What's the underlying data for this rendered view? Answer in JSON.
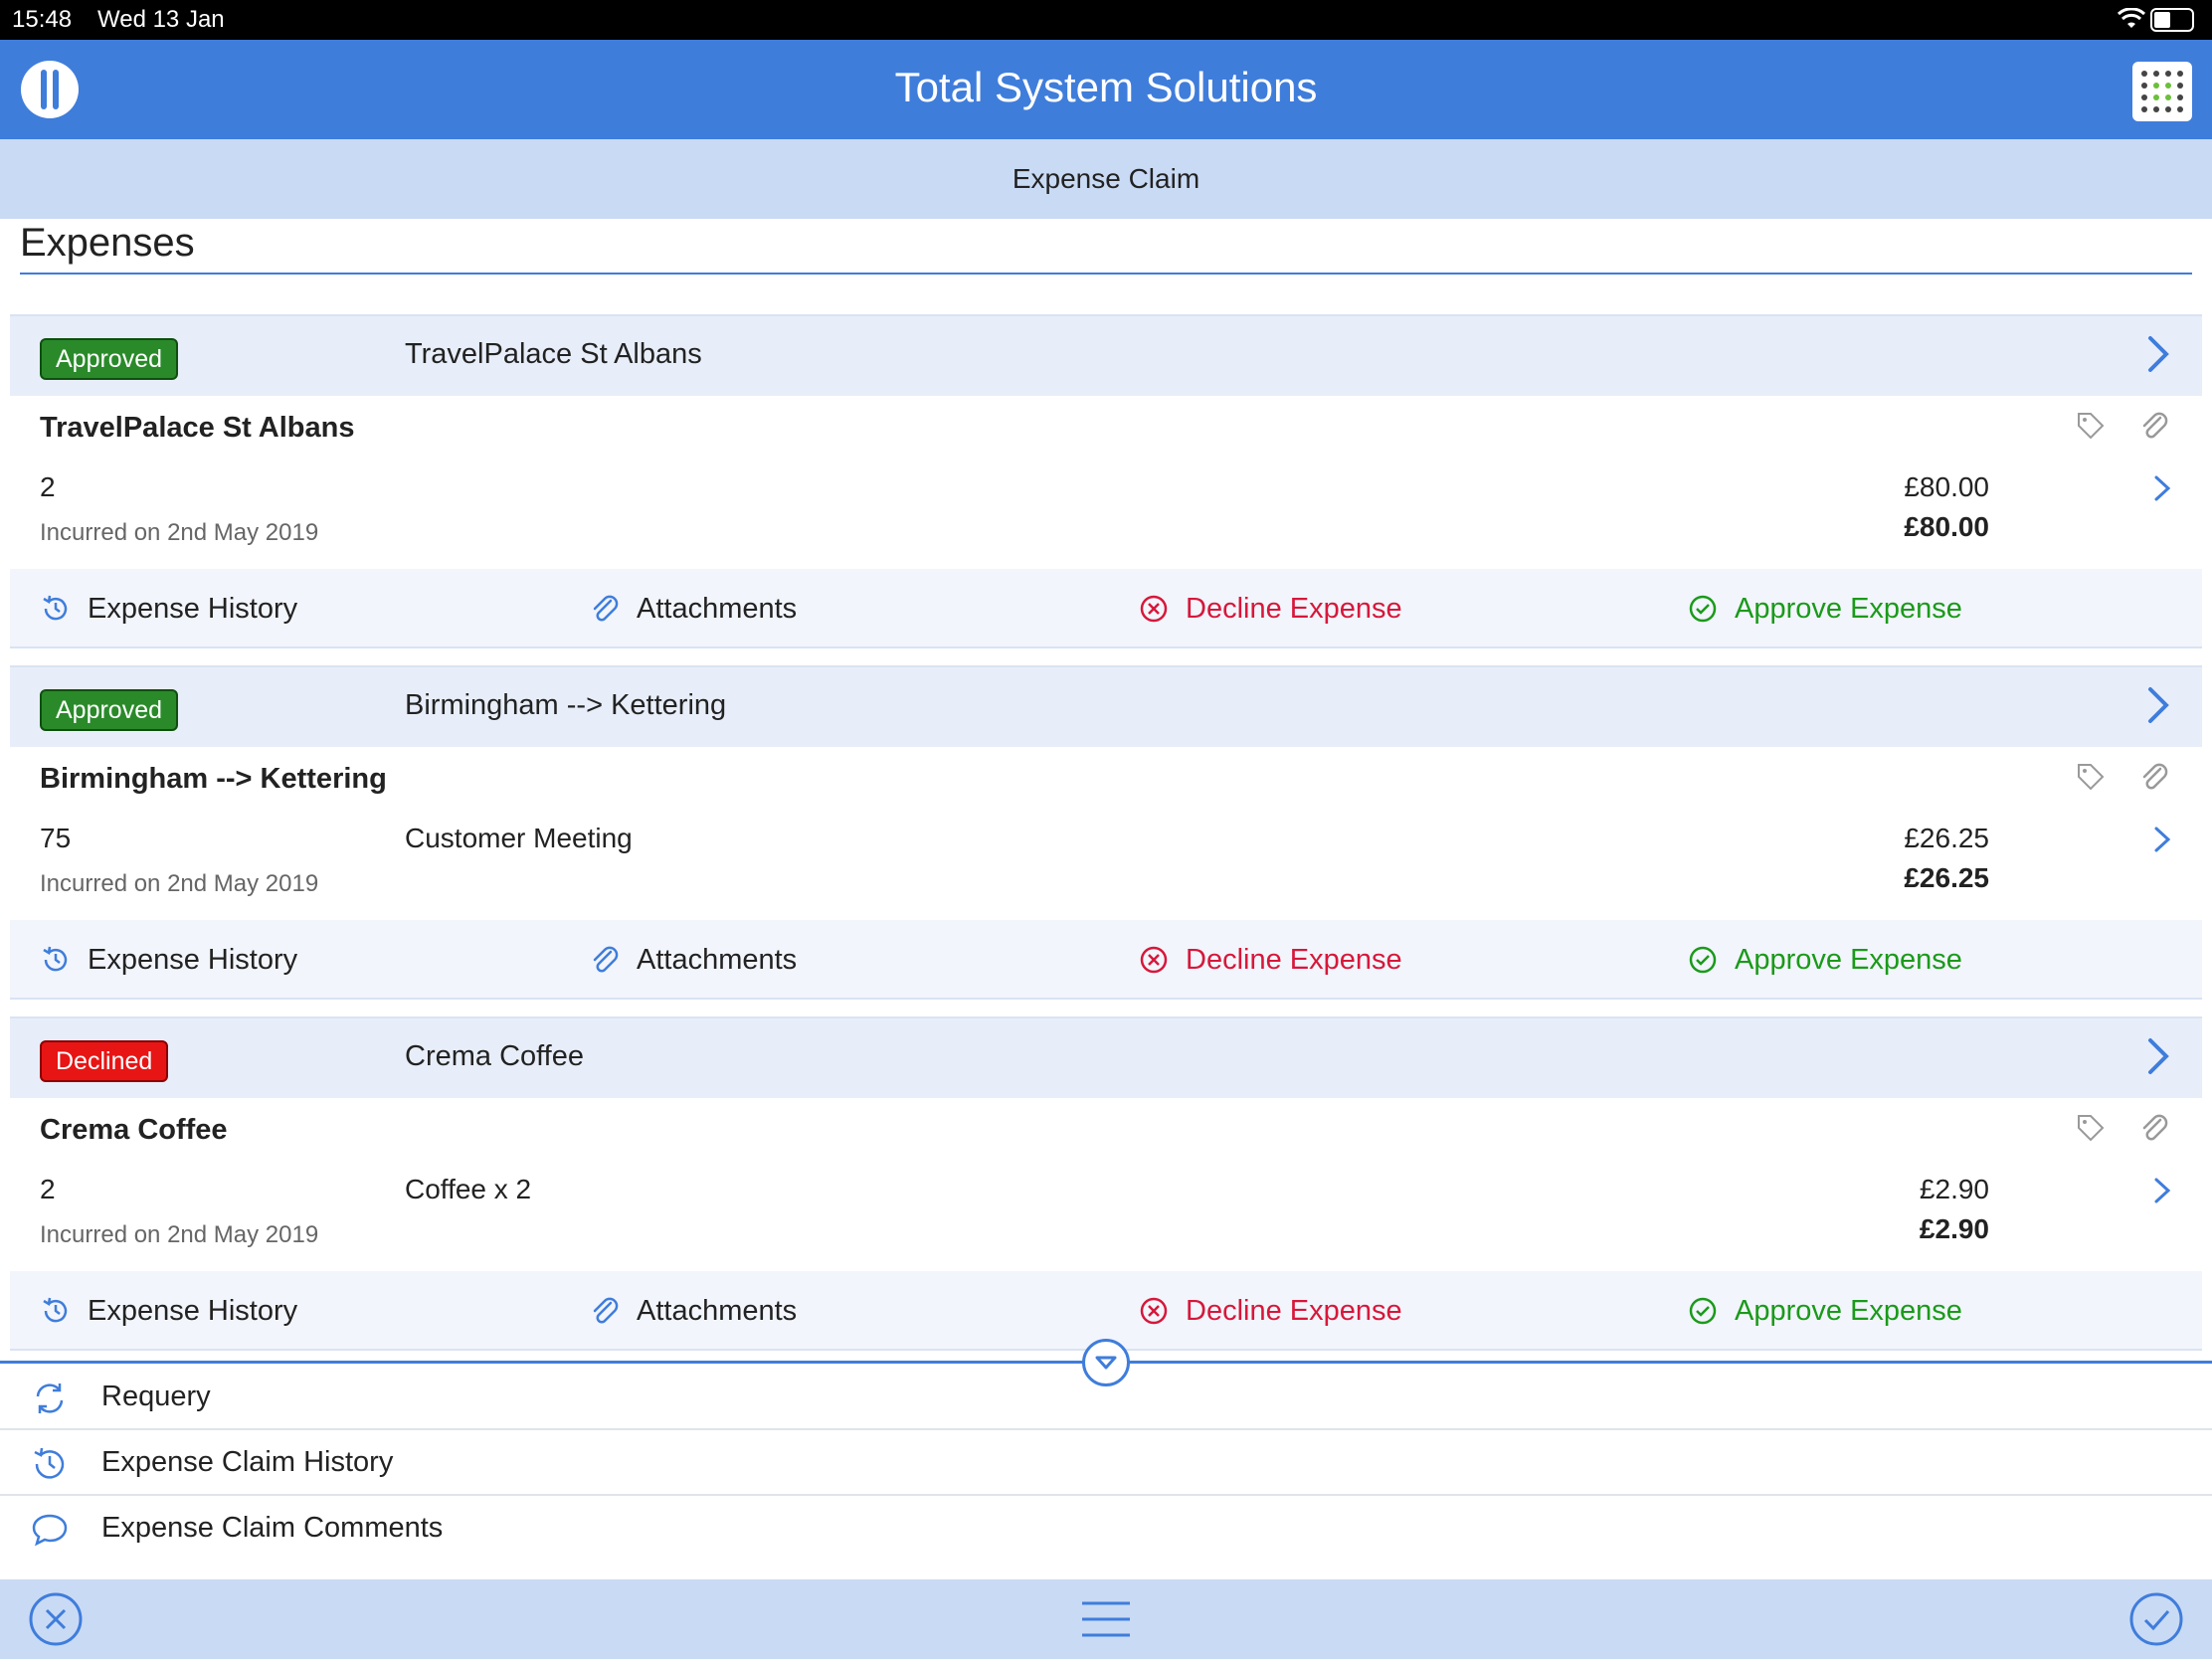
{
  "status_bar": {
    "time": "15:48",
    "date": "Wed 13 Jan"
  },
  "app": {
    "title": "Total System Solutions",
    "subtitle": "Expense Claim"
  },
  "section": {
    "title": "Expenses"
  },
  "colors": {
    "accent": "#3f7ddb",
    "approved": "#2a8a2a",
    "declined": "#e81515",
    "decline_text": "#d7173b",
    "approve_text": "#1a9a1a"
  },
  "expenses": [
    {
      "status": "Approved",
      "header_name": "TravelPalace St Albans",
      "title": "TravelPalace St Albans",
      "quantity": "2",
      "description": "",
      "amount": "£80.00",
      "total": "£80.00",
      "incurred": "Incurred on 2nd May 2019"
    },
    {
      "status": "Approved",
      "header_name": "Birmingham --> Kettering",
      "title": "Birmingham --> Kettering",
      "quantity": "75",
      "description": "Customer Meeting",
      "amount": "£26.25",
      "total": "£26.25",
      "incurred": "Incurred on 2nd May 2019"
    },
    {
      "status": "Declined",
      "header_name": "Crema Coffee",
      "title": "Crema Coffee",
      "quantity": "2",
      "description": "Coffee x 2",
      "amount": "£2.90",
      "total": "£2.90",
      "incurred": "Incurred on 2nd May 2019"
    }
  ],
  "actions": {
    "history": "Expense History",
    "attachments": "Attachments",
    "decline": "Decline Expense",
    "approve": "Approve Expense"
  },
  "menu": [
    {
      "label": "Requery",
      "icon": "refresh-icon"
    },
    {
      "label": "Expense Claim History",
      "icon": "history-icon"
    },
    {
      "label": "Expense Claim Comments",
      "icon": "comment-icon"
    }
  ],
  "bottom_bar": {
    "cancel_icon": "close-circle-icon",
    "menu_icon": "hamburger-icon",
    "confirm_icon": "check-circle-icon"
  }
}
